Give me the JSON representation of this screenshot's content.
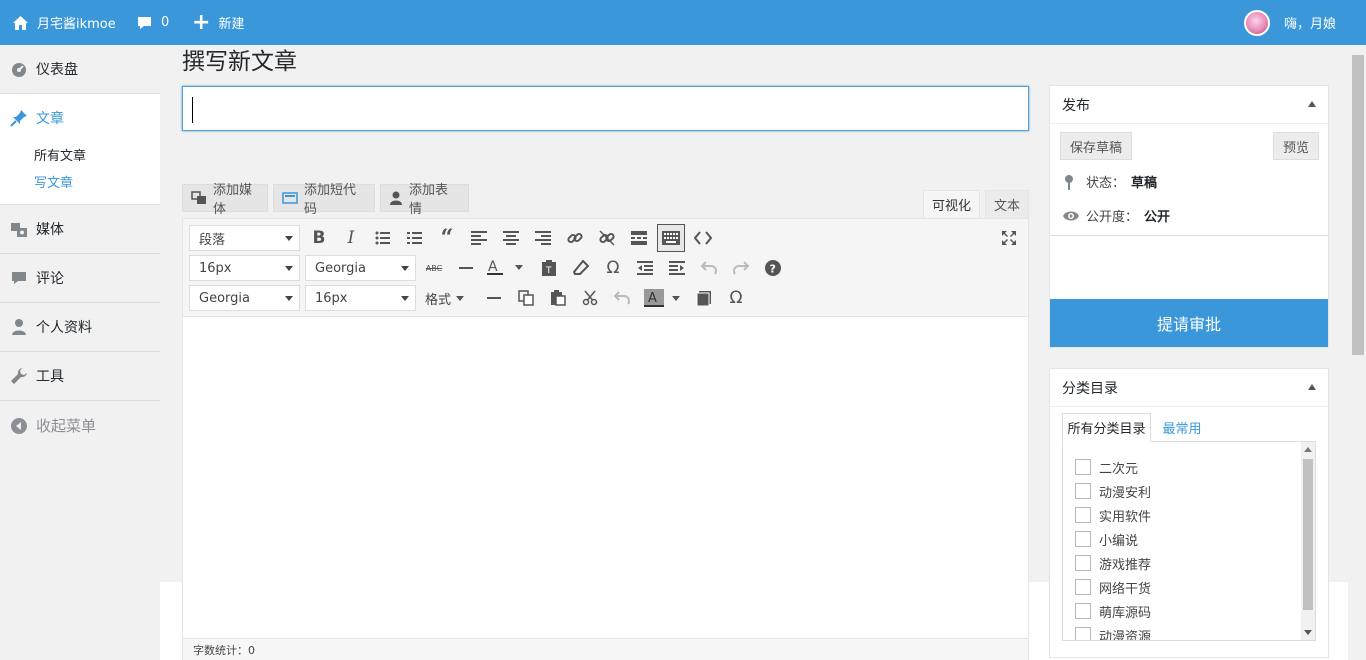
{
  "topbar": {
    "site_name": "月宅酱ikmoe",
    "comments_count": "0",
    "new_label": "新建",
    "greeting": "嗨，月娘"
  },
  "sidebar": {
    "dashboard": "仪表盘",
    "posts": "文章",
    "posts_sub": [
      "所有文章",
      "写文章"
    ],
    "media": "媒体",
    "comments": "评论",
    "profile": "个人资料",
    "tools": "工具",
    "collapse": "收起菜单"
  },
  "page": {
    "title": "撰写新文章"
  },
  "editor": {
    "title_value": "",
    "add_media": "添加媒体",
    "add_shortcode": "添加短代码",
    "add_emoji": "添加表情",
    "tab_visual": "可视化",
    "tab_text": "文本",
    "format_select": "段落",
    "font_size_1": "16px",
    "font_family_1": "Georgia",
    "font_family_2": "Georgia",
    "font_size_2": "16px",
    "formats_menu": "格式",
    "word_count": "字数统计：0"
  },
  "publish": {
    "title": "发布",
    "save_draft": "保存草稿",
    "preview": "预览",
    "status_label": "状态：",
    "status_value": "草稿",
    "visibility_label": "公开度：",
    "visibility_value": "公开",
    "submit": "提请审批"
  },
  "categories": {
    "title": "分类目录",
    "tab_all": "所有分类目录",
    "tab_popular": "最常用",
    "items": [
      "二次元",
      "动漫安利",
      "实用软件",
      "小编说",
      "游戏推荐",
      "网络干货",
      "萌库源码",
      "动漫资源"
    ]
  },
  "colors": {
    "accent": "#3a97d9",
    "topbar": "#3a97d9"
  }
}
